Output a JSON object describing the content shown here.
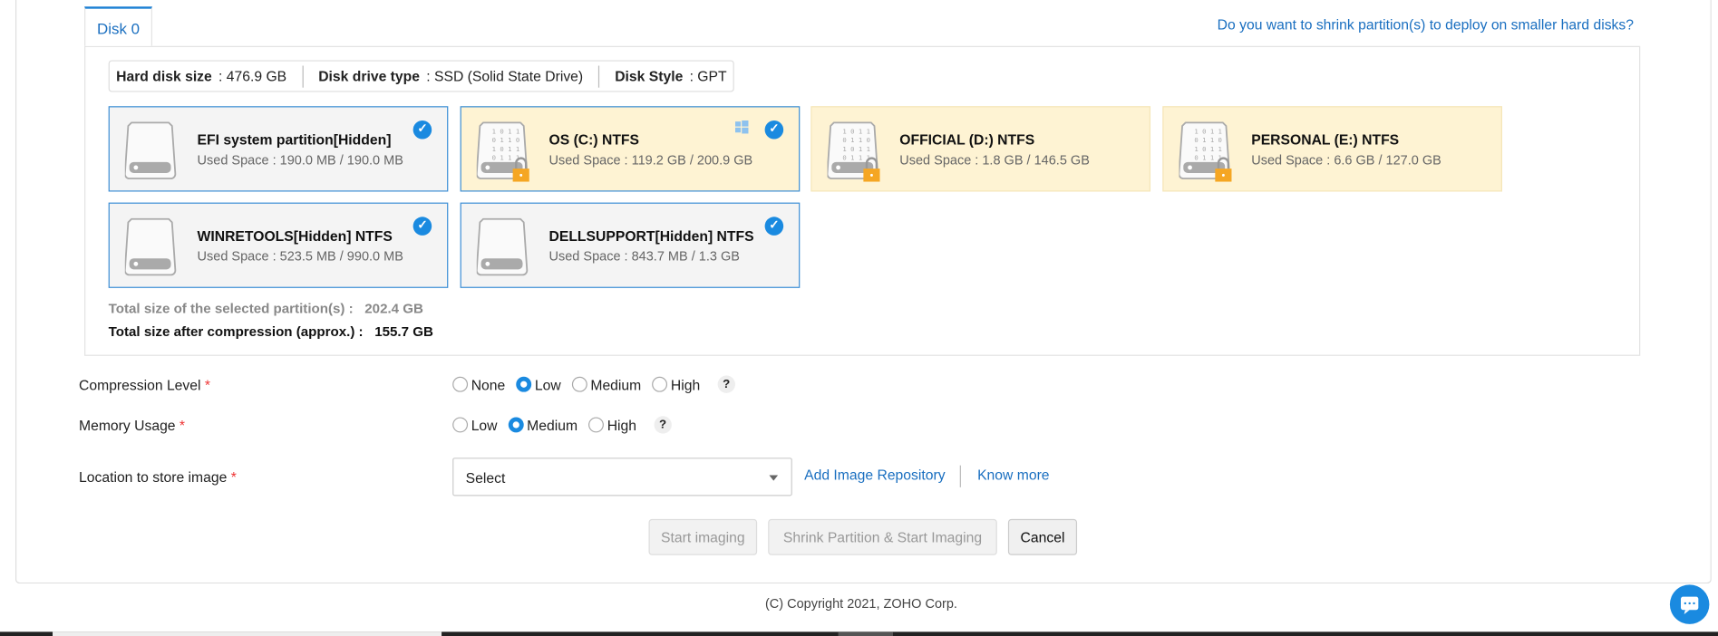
{
  "tab": {
    "label": "Disk 0"
  },
  "shrink_link": "Do you want to shrink partition(s) to deploy on smaller hard disks?",
  "disk_info": {
    "size_label": "Hard disk size",
    ":": ":",
    "size_value": ": 476.9 GB",
    "type_label": "Disk drive type",
    "type_value": ": SSD (Solid State Drive)",
    "style_label": "Disk Style",
    "style_value": ": GPT"
  },
  "partitions": [
    {
      "name": "EFI system partition[Hidden]",
      "used": "Used Space : 190.0 MB / 190.0 MB",
      "selected": true,
      "locked": false
    },
    {
      "name": "OS (C:) NTFS",
      "used": "Used Space : 119.2 GB / 200.9 GB",
      "selected": true,
      "locked": true,
      "windows": true
    },
    {
      "name": "OFFICIAL (D:) NTFS",
      "used": "Used Space : 1.8 GB / 146.5 GB",
      "selected": false,
      "locked": true
    },
    {
      "name": "PERSONAL (E:) NTFS",
      "used": "Used Space : 6.6 GB / 127.0 GB",
      "selected": false,
      "locked": true
    },
    {
      "name": "WINRETOOLS[Hidden] NTFS",
      "used": "Used Space : 523.5 MB / 990.0 MB",
      "selected": true,
      "locked": false
    },
    {
      "name": "DELLSUPPORT[Hidden] NTFS",
      "used": "Used Space : 843.7 MB / 1.3 GB",
      "selected": true,
      "locked": false
    }
  ],
  "totals": {
    "selected_label": "Total size of the selected partition(s) :",
    "selected_value": "202.4 GB",
    "compressed_label": "Total size after compression (approx.) :",
    "compressed_value": "155.7 GB"
  },
  "form": {
    "required_mark": "*",
    "compression": {
      "label": "Compression Level",
      "options": [
        "None",
        "Low",
        "Medium",
        "High"
      ],
      "selected": "Low",
      "help": "?"
    },
    "memory": {
      "label": "Memory Usage",
      "options": [
        "Low",
        "Medium",
        "High"
      ],
      "selected": "Medium",
      "help": "?"
    },
    "location": {
      "label": "Location to store image",
      "value": "Select",
      "add_repo": "Add Image Repository",
      "know_more": "Know more"
    }
  },
  "buttons": {
    "start": "Start imaging",
    "shrink_start": "Shrink Partition & Start Imaging",
    "cancel": "Cancel"
  },
  "footer": "(C) Copyright 2021, ZOHO Corp.",
  "colors": {
    "accent": "#1a8ae0",
    "link": "#1a6fc0",
    "locked_bg": "#fef3d3"
  }
}
